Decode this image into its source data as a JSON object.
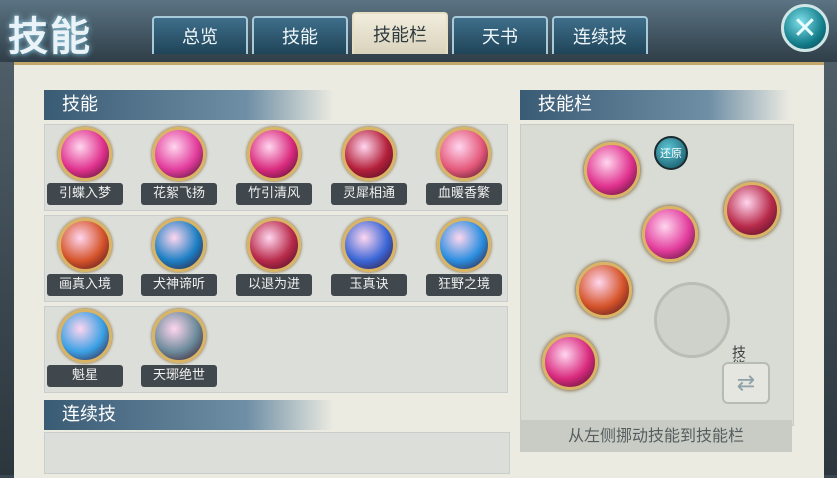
{
  "header": {
    "logo_text": "技能",
    "tabs": [
      {
        "label": "总览",
        "active": false
      },
      {
        "label": "技能",
        "active": false
      },
      {
        "label": "技能栏",
        "active": true
      },
      {
        "label": "天书",
        "active": false
      },
      {
        "label": "连续技",
        "active": false
      }
    ],
    "close_symbol": "✕"
  },
  "skills_section": {
    "title": "技能",
    "skills": [
      {
        "name": "引蝶入梦",
        "icon": "butterfly-dream-icon",
        "color": "#e0328e"
      },
      {
        "name": "花絮飞扬",
        "icon": "petal-flurry-icon",
        "color": "#e23c9c"
      },
      {
        "name": "竹引清风",
        "icon": "bamboo-wind-icon",
        "color": "#d92a7e"
      },
      {
        "name": "灵犀相通",
        "icon": "spirit-link-icon",
        "color": "#b4203a"
      },
      {
        "name": "血暖香繁",
        "icon": "blood-warmth-icon",
        "color": "#e4587a"
      },
      {
        "name": "画真入境",
        "icon": "painting-icon",
        "color": "#d5542a"
      },
      {
        "name": "犬神谛听",
        "icon": "dog-spirit-icon",
        "color": "#1c7fc4"
      },
      {
        "name": "以退为进",
        "icon": "retreat-icon",
        "color": "#b82a4a"
      },
      {
        "name": "玉真诀",
        "icon": "jade-icon",
        "color": "#3a66d6"
      },
      {
        "name": "狂野之境",
        "icon": "wild-realm-icon",
        "color": "#2a8ee0"
      },
      {
        "name": "魁星",
        "icon": "star-icon",
        "color": "#3aa0e4"
      },
      {
        "name": "天琊绝世",
        "icon": "tianya-icon",
        "color": "#6a8a9a"
      }
    ]
  },
  "combo_section": {
    "title": "连续技"
  },
  "skillbar_section": {
    "title": "技能栏",
    "restore_label": "还原",
    "switch_label_1": "技能栏二",
    "hint": "从左侧挪动技能到技能栏",
    "slot_colors": [
      "#e0328e",
      "#b82a4a",
      "#e23c9c",
      "#d5542a",
      "#d92a7e"
    ]
  }
}
